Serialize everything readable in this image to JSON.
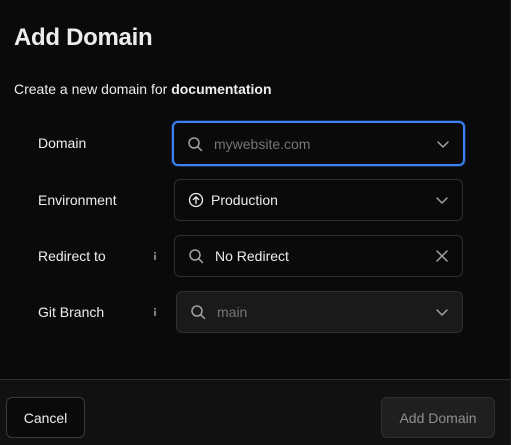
{
  "dialog": {
    "title": "Add Domain",
    "subtitle_prefix": "Create a new domain for ",
    "project_name": "documentation"
  },
  "form": {
    "domain": {
      "label": "Domain",
      "placeholder": "mywebsite.com",
      "value": ""
    },
    "environment": {
      "label": "Environment",
      "value": "Production"
    },
    "redirect": {
      "label": "Redirect to",
      "value": "No Redirect"
    },
    "git_branch": {
      "label": "Git Branch",
      "placeholder": "main",
      "value": ""
    }
  },
  "footer": {
    "cancel_label": "Cancel",
    "submit_label": "Add Domain"
  },
  "icons": {
    "search": "search-icon",
    "chevron": "chevron-down-icon",
    "environment": "arrow-up-circle-icon",
    "clear": "close-icon",
    "info": "info-icon"
  },
  "colors": {
    "background": "#0a0a0a",
    "focus_ring": "#3b82f6",
    "text": "#ededed",
    "muted": "#8f8f8f",
    "border": "#2e2e2e"
  }
}
